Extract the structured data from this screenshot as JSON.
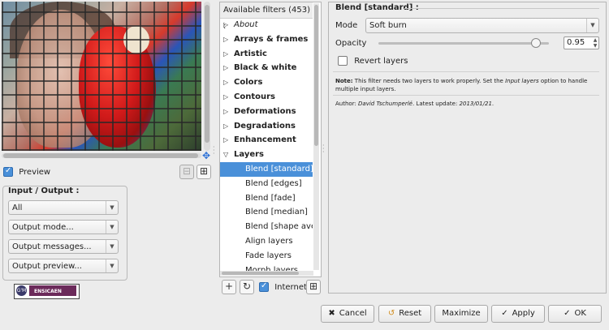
{
  "preview": {
    "checkbox_label": "Preview",
    "checked": true
  },
  "io": {
    "title": "Input / Output :",
    "input_layers": "All",
    "output_mode": "Output mode...",
    "output_messages": "Output messages...",
    "output_preview": "Output preview..."
  },
  "logo": {
    "text": "ENSICAEN"
  },
  "filters": {
    "header": "Available filters (453) :",
    "items": [
      {
        "label": "About",
        "kind": "cat-italic",
        "expanded": false
      },
      {
        "label": "Arrays & frames",
        "kind": "cat",
        "expanded": false
      },
      {
        "label": "Artistic",
        "kind": "cat",
        "expanded": false
      },
      {
        "label": "Black & white",
        "kind": "cat",
        "expanded": false
      },
      {
        "label": "Colors",
        "kind": "cat",
        "expanded": false
      },
      {
        "label": "Contours",
        "kind": "cat",
        "expanded": false
      },
      {
        "label": "Deformations",
        "kind": "cat",
        "expanded": false
      },
      {
        "label": "Degradations",
        "kind": "cat",
        "expanded": false
      },
      {
        "label": "Enhancement",
        "kind": "cat",
        "expanded": false
      },
      {
        "label": "Layers",
        "kind": "cat",
        "expanded": true
      },
      {
        "label": "Blend [standard]",
        "kind": "sub",
        "selected": true
      },
      {
        "label": "Blend [edges]",
        "kind": "sub"
      },
      {
        "label": "Blend [fade]",
        "kind": "sub"
      },
      {
        "label": "Blend [median]",
        "kind": "sub"
      },
      {
        "label": "Blend [shape average]",
        "kind": "sub"
      },
      {
        "label": "Align layers",
        "kind": "sub"
      },
      {
        "label": "Fade layers",
        "kind": "sub"
      },
      {
        "label": "Morph layers",
        "kind": "sub"
      }
    ],
    "internet_label": "Internet",
    "internet_checked": true
  },
  "params": {
    "title": "Blend [standard] :",
    "mode_label": "Mode",
    "mode_value": "Soft burn",
    "opacity_label": "Opacity",
    "opacity_value": "0.95",
    "opacity_level": 0.95,
    "revert_label": "Revert layers",
    "revert_checked": false,
    "note_bold": "Note:",
    "note_part1": " This filter needs two layers to work properly. Set the ",
    "note_italic": "Input layers",
    "note_part2": " option to handle multiple input layers.",
    "author_prefix": "Author: ",
    "author_name": "David Tschumperlé",
    "update_prefix": ".    Latest update: ",
    "update_date": "2013/01/21",
    "update_suffix": "."
  },
  "buttons": {
    "cancel": "Cancel",
    "reset": "Reset",
    "maximize": "Maximize",
    "apply": "Apply",
    "ok": "OK"
  },
  "colors": {
    "selection": "#4a90d9",
    "accent_icon": "#2a6fd6"
  }
}
